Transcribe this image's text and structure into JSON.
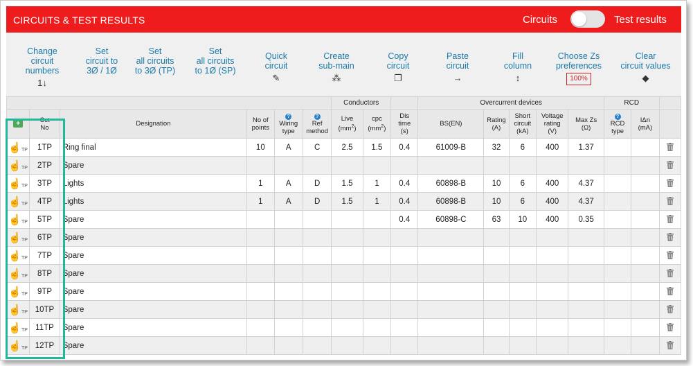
{
  "header": {
    "title": "CIRCUITS & TEST RESULTS",
    "toggle_left_label": "Circuits",
    "toggle_right_label": "Test results",
    "bar_color": "#ee1c1c"
  },
  "toolbar": [
    {
      "name": "change-circuit-numbers-button",
      "label": "Change\ncircuit\nnumbers",
      "icon": "1↓",
      "icon_name": "sort-numeric-icon"
    },
    {
      "name": "set-circuit-to-3ph-1ph-button",
      "label": "Set\ncircuit to\n3Ø / 1Ø",
      "icon": "",
      "icon_name": ""
    },
    {
      "name": "set-all-circuits-tp-button",
      "label": "Set\nall circuits\nto 3Ø (TP)",
      "icon": "",
      "icon_name": ""
    },
    {
      "name": "set-all-circuits-sp-button",
      "label": "Set\nall circuits\nto 1Ø (SP)",
      "icon": "",
      "icon_name": ""
    },
    {
      "name": "quick-circuit-button",
      "label": "Quick\ncircuit",
      "icon": "✎",
      "icon_name": "magic-wand-icon"
    },
    {
      "name": "create-sub-main-button",
      "label": "Create\nsub-main",
      "icon": "⁂",
      "icon_name": "sitemap-icon"
    },
    {
      "name": "copy-circuit-button",
      "label": "Copy\ncircuit",
      "icon": "❐",
      "icon_name": "copy-icon"
    },
    {
      "name": "paste-circuit-button",
      "label": "Paste\ncircuit",
      "icon": "→",
      "icon_name": "arrow-right-icon"
    },
    {
      "name": "fill-column-button",
      "label": "Fill\ncolumn",
      "icon": "↕",
      "icon_name": "vertical-arrows-icon"
    },
    {
      "name": "choose-zs-preferences-button",
      "label": "Choose Zs\npreferences",
      "icon": "",
      "icon_name": "",
      "badge": "100%"
    },
    {
      "name": "clear-circuit-values-button",
      "label": "Clear\ncircuit values",
      "icon": "◆",
      "icon_name": "eraser-icon"
    }
  ],
  "groups": {
    "conductors": "Conductors",
    "overcurrent": "Overcurrent devices",
    "rcd": "RCD"
  },
  "columns": {
    "cct_no": "Cct\nNo",
    "designation": "Designation",
    "no_of_points": "No of\npoints",
    "wiring_type": "Wiring\ntype",
    "ref_method": "Ref\nmethod",
    "live": "Live",
    "cpc": "cpc",
    "mm2": "(mm",
    "dis_time": "Dis\ntime\n(s)",
    "bs_en": "BS(EN)",
    "rating": "Rating\n(A)",
    "short_circuit": "Short\ncircuit\n(kA)",
    "voltage_rating": "Voltage\nrating\n(V)",
    "max_zs": "Max Zs\n(Ω)",
    "rcd_type": "RCD\ntype",
    "idn": "IΔn\n(mA)"
  },
  "rows": [
    {
      "no": "1TP",
      "designation": "Ring final",
      "points": "10",
      "wiring": "A",
      "ref": "C",
      "live": "2.5",
      "cpc": "1.5",
      "dis": "0.4",
      "bs": "61009-B",
      "rating": "32",
      "sc": "6",
      "volt": "400",
      "zs": "1.37",
      "rcd_type": "",
      "idn": ""
    },
    {
      "no": "2TP",
      "designation": "Spare",
      "points": "",
      "wiring": "",
      "ref": "",
      "live": "",
      "cpc": "",
      "dis": "",
      "bs": "",
      "rating": "",
      "sc": "",
      "volt": "",
      "zs": "",
      "rcd_type": "",
      "idn": ""
    },
    {
      "no": "3TP",
      "designation": "Lights",
      "points": "1",
      "wiring": "A",
      "ref": "D",
      "live": "1.5",
      "cpc": "1",
      "dis": "0.4",
      "bs": "60898-B",
      "rating": "10",
      "sc": "6",
      "volt": "400",
      "zs": "4.37",
      "rcd_type": "",
      "idn": ""
    },
    {
      "no": "4TP",
      "designation": "Lights",
      "points": "1",
      "wiring": "A",
      "ref": "D",
      "live": "1.5",
      "cpc": "1",
      "dis": "0.4",
      "bs": "60898-B",
      "rating": "10",
      "sc": "6",
      "volt": "400",
      "zs": "4.37",
      "rcd_type": "",
      "idn": ""
    },
    {
      "no": "5TP",
      "designation": "Spare",
      "points": "",
      "wiring": "",
      "ref": "",
      "live": "",
      "cpc": "",
      "dis": "0.4",
      "bs": "60898-C",
      "rating": "63",
      "sc": "10",
      "volt": "400",
      "zs": "0.35",
      "rcd_type": "",
      "idn": ""
    },
    {
      "no": "6TP",
      "designation": "Spare",
      "points": "",
      "wiring": "",
      "ref": "",
      "live": "",
      "cpc": "",
      "dis": "",
      "bs": "",
      "rating": "",
      "sc": "",
      "volt": "",
      "zs": "",
      "rcd_type": "",
      "idn": ""
    },
    {
      "no": "7TP",
      "designation": "Spare",
      "points": "",
      "wiring": "",
      "ref": "",
      "live": "",
      "cpc": "",
      "dis": "",
      "bs": "",
      "rating": "",
      "sc": "",
      "volt": "",
      "zs": "",
      "rcd_type": "",
      "idn": ""
    },
    {
      "no": "8TP",
      "designation": "Spare",
      "points": "",
      "wiring": "",
      "ref": "",
      "live": "",
      "cpc": "",
      "dis": "",
      "bs": "",
      "rating": "",
      "sc": "",
      "volt": "",
      "zs": "",
      "rcd_type": "",
      "idn": ""
    },
    {
      "no": "9TP",
      "designation": "Spare",
      "points": "",
      "wiring": "",
      "ref": "",
      "live": "",
      "cpc": "",
      "dis": "",
      "bs": "",
      "rating": "",
      "sc": "",
      "volt": "",
      "zs": "",
      "rcd_type": "",
      "idn": ""
    },
    {
      "no": "10TP",
      "designation": "Spare",
      "points": "",
      "wiring": "",
      "ref": "",
      "live": "",
      "cpc": "",
      "dis": "",
      "bs": "",
      "rating": "",
      "sc": "",
      "volt": "",
      "zs": "",
      "rcd_type": "",
      "idn": ""
    },
    {
      "no": "11TP",
      "designation": "Spare",
      "points": "",
      "wiring": "",
      "ref": "",
      "live": "",
      "cpc": "",
      "dis": "",
      "bs": "",
      "rating": "",
      "sc": "",
      "volt": "",
      "zs": "",
      "rcd_type": "",
      "idn": ""
    },
    {
      "no": "12TP",
      "designation": "Spare",
      "points": "",
      "wiring": "",
      "ref": "",
      "live": "",
      "cpc": "",
      "dis": "",
      "bs": "",
      "rating": "",
      "sc": "",
      "volt": "",
      "zs": "",
      "rcd_type": "",
      "idn": ""
    }
  ],
  "row_handle_suffix": "TP",
  "highlight_color": "#21b89a"
}
